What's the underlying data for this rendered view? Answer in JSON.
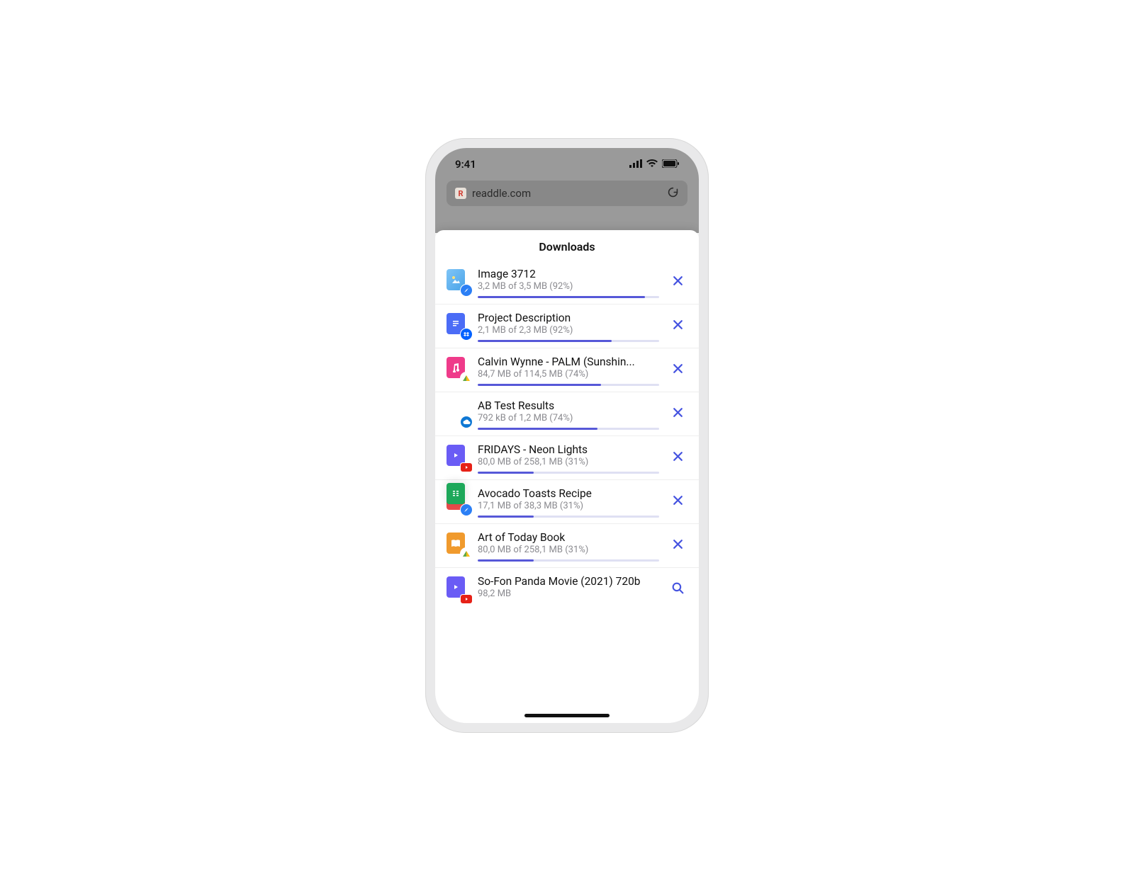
{
  "status_bar": {
    "time": "9:41"
  },
  "url_bar": {
    "favicon_letter": "R",
    "url_text": "readdle.com"
  },
  "sheet": {
    "title": "Downloads"
  },
  "downloads": [
    {
      "title": "Image 3712",
      "subtitle": "3,2 MB of 3,5 MB (92%)",
      "progress": 92,
      "file_kind": "image",
      "source": "safari",
      "action": "cancel"
    },
    {
      "title": "Project Description",
      "subtitle": "2,1 MB of 2,3 MB (92%)",
      "progress": 74,
      "file_kind": "doc",
      "source": "dropbox",
      "action": "cancel"
    },
    {
      "title": "Calvin Wynne - PALM (Sunshin...",
      "subtitle": "84,7 MB of 114,5 MB (74%)",
      "progress": 68,
      "file_kind": "music",
      "source": "gdrive",
      "action": "cancel"
    },
    {
      "title": "AB Test Results",
      "subtitle": "792 kB of 1,2 MB (74%)",
      "progress": 66,
      "file_kind": "sheet",
      "source": "onedrive",
      "action": "cancel"
    },
    {
      "title": "FRIDAYS - Neon Lights",
      "subtitle": "80,0 MB of 258,1 MB (31%)",
      "progress": 31,
      "file_kind": "video",
      "source": "youtube",
      "action": "cancel"
    },
    {
      "title": "Avocado Toasts Recipe",
      "subtitle": "17,1 MB of 38,3 MB (31%)",
      "progress": 31,
      "file_kind": "pdf",
      "source": "safari",
      "action": "cancel"
    },
    {
      "title": "Art of Today Book",
      "subtitle": "80,0 MB of 258,1 MB (31%)",
      "progress": 31,
      "file_kind": "book",
      "source": "gdrive",
      "action": "cancel"
    },
    {
      "title": "So-Fon Panda Movie (2021) 720b",
      "subtitle": "98,2 MB",
      "progress": null,
      "file_kind": "video",
      "source": "youtube",
      "action": "search"
    }
  ]
}
